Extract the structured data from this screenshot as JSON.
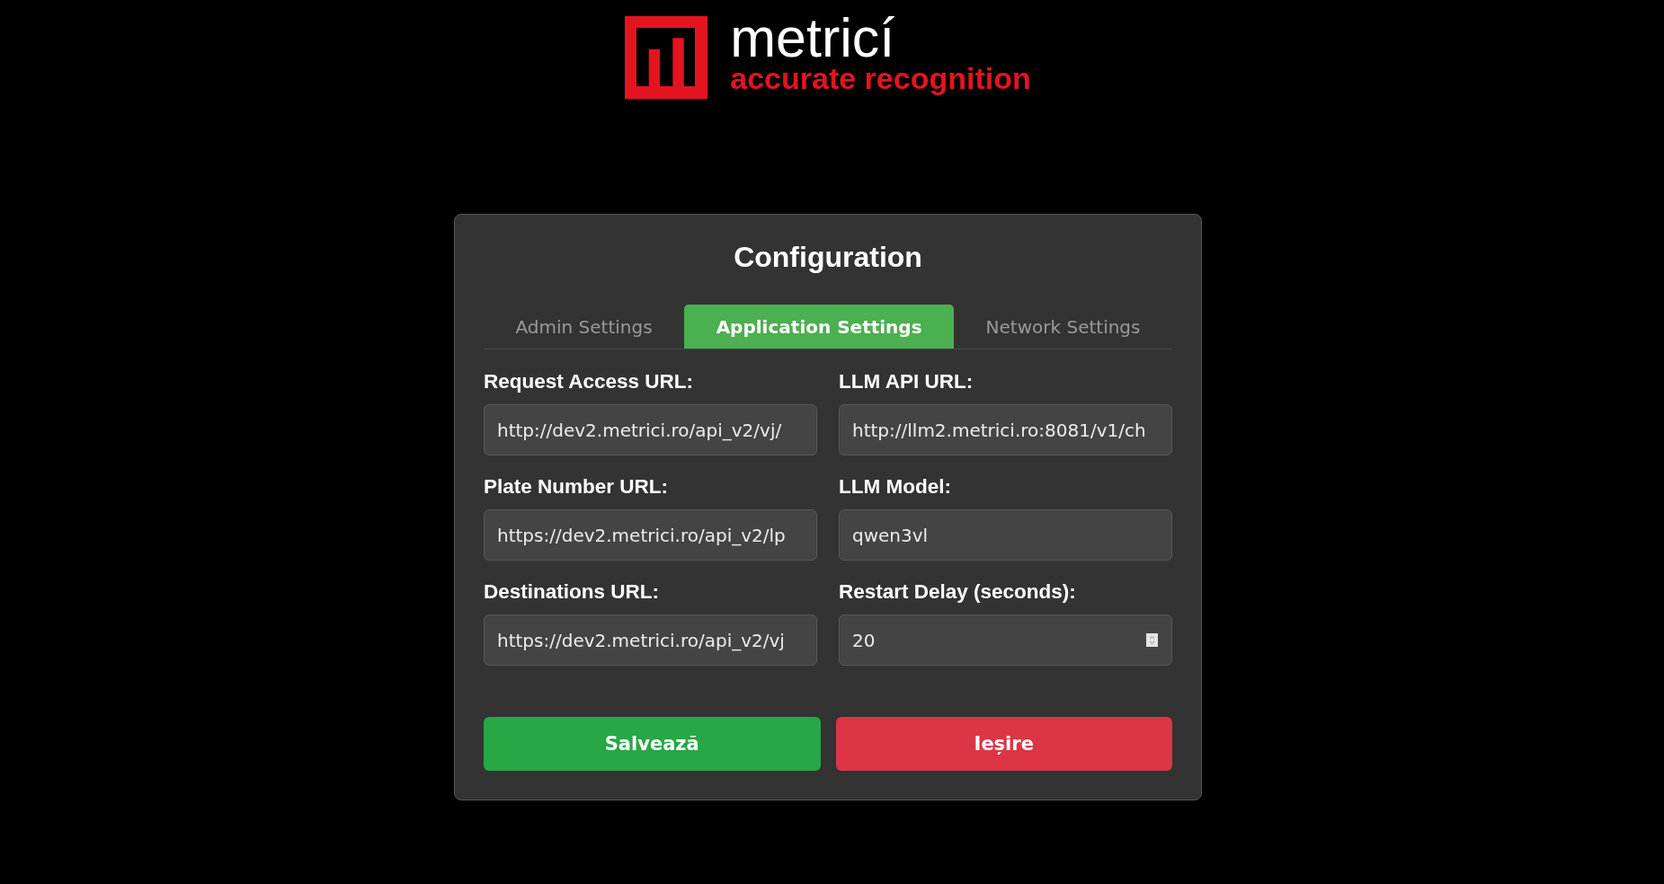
{
  "logo": {
    "name": "metricí",
    "tagline": "accurate recognition"
  },
  "dialog": {
    "title": "Configuration",
    "tabs": [
      {
        "label": "Admin Settings",
        "selected": false
      },
      {
        "label": "Application Settings",
        "selected": true
      },
      {
        "label": "Network Settings",
        "selected": false
      }
    ],
    "fields": [
      {
        "label": "Request Access URL:",
        "value": "http://dev2.metrici.ro/api_v2/vj/",
        "kind": "text"
      },
      {
        "label": "LLM API URL:",
        "value": "http://llm2.metrici.ro:8081/v1/ch",
        "kind": "text"
      },
      {
        "label": "Plate Number URL:",
        "value": "https://dev2.metrici.ro/api_v2/lp",
        "kind": "text"
      },
      {
        "label": "LLM Model:",
        "value": "qwen3vl",
        "kind": "text"
      },
      {
        "label": "Destinations URL:",
        "value": "https://dev2.metrici.ro/api_v2/vj",
        "kind": "text"
      },
      {
        "label": "Restart Delay (seconds):",
        "value": "20",
        "kind": "number"
      }
    ],
    "buttons": [
      {
        "label": "Salvează",
        "kind": "primary"
      },
      {
        "label": "Ieșire",
        "kind": "danger"
      }
    ]
  }
}
